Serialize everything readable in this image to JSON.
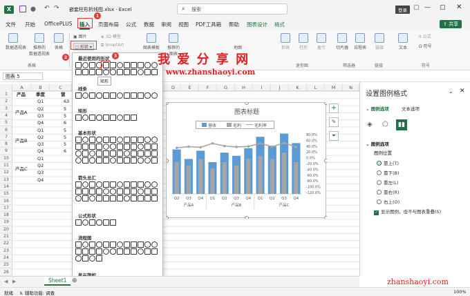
{
  "titlebar": {
    "filename": "嵌套柱形折线图.xlsx · Excel",
    "search_placeholder": "搜索",
    "login": "登录"
  },
  "tabs": [
    "文件",
    "开始",
    "OfficePLUS",
    "插入",
    "页面布局",
    "公式",
    "数据",
    "审阅",
    "视图",
    "PDF工具箱",
    "帮助",
    "图表设计",
    "格式"
  ],
  "share": "共享",
  "ribbon": {
    "buttons": {
      "pivot": "数据透视表",
      "recommended_pivot": "推荐的\n数据透视表",
      "table": "表格",
      "picture": "图片",
      "shape": "形状",
      "model3d": "3D 模型",
      "smartart": "SmartArt",
      "chart_template": "图表模板",
      "recommended_chart": "推荐的\n图表",
      "map": "地图",
      "line_spark": "折线",
      "column_spark": "柱形",
      "winloss": "盈亏",
      "slicer": "切片器",
      "timeline": "日程表",
      "link": "链接",
      "text": "文本",
      "symbol": "符号",
      "formula_sym": "公式",
      "omega": "Ω 符号"
    },
    "groups": {
      "tables": "表格",
      "sparklines": "迷你图",
      "filters": "筛选器",
      "links": "链接",
      "symbols": "符号"
    }
  },
  "namebox": "图表 5",
  "fx": "fx",
  "columns": [
    "A",
    "B",
    "C",
    "D",
    "E",
    "F",
    "G",
    "H",
    "I",
    "J",
    "K",
    "L",
    "M",
    "N"
  ],
  "rows": [
    "1",
    "2",
    "3",
    "4",
    "5",
    "6",
    "7",
    "8",
    "9",
    "10",
    "11",
    "12",
    "13",
    "14",
    "15",
    "16",
    "17",
    "18",
    "19",
    "20",
    "21",
    "22",
    "23",
    "24",
    "25",
    "26"
  ],
  "table": {
    "header": [
      "产品",
      "季度",
      "营"
    ],
    "groups": [
      {
        "name": "产品A",
        "quarters": [
          "Q1",
          "Q2",
          "Q3",
          "Q4"
        ],
        "partial": [
          "63",
          "5",
          "5",
          "6"
        ]
      },
      {
        "name": "产品B",
        "quarters": [
          "Q1",
          "Q2",
          "Q3",
          "Q4"
        ],
        "partial": [
          "5",
          "5",
          "5",
          "6"
        ]
      },
      {
        "name": "产品C",
        "quarters": [
          "Q1",
          "Q2",
          "Q3",
          "Q4"
        ],
        "partial": [
          "",
          "",
          "",
          ""
        ]
      }
    ]
  },
  "dropdown": {
    "recent": "最近使用的形状",
    "tooltip": "矩形",
    "lines": "线条",
    "rect": "矩形",
    "basic": "基本形状",
    "arrows": "箭头总汇",
    "equation": "公式形状",
    "flowchart": "流程图",
    "stars": "星与旗帜"
  },
  "chart_data": {
    "type": "bar",
    "title": "图表标题",
    "legend": [
      "营收",
      "毛利",
      "毛利率"
    ],
    "categories": [
      "Q2",
      "Q3",
      "Q4",
      "Q1",
      "Q2",
      "Q3",
      "Q4",
      "Q1",
      "Q2",
      "Q3",
      "Q4"
    ],
    "group_labels": [
      "产品A",
      "产品B",
      "产品C"
    ],
    "right_axis": [
      "80.0%",
      "60.0%",
      "40.0%",
      "20.0%",
      "0.0%",
      "-20.0%",
      "-40.0%",
      "-60.0%",
      "-80.0%",
      "-100.0%",
      "-120.0%"
    ],
    "series": [
      {
        "name": "营收",
        "values": [
          0.7,
          0.55,
          0.68,
          0.5,
          0.65,
          0.6,
          0.72,
          0.9,
          0.75,
          0.95,
          0.8
        ]
      },
      {
        "name": "毛利",
        "values": [
          0.5,
          0.45,
          0.55,
          0.4,
          0.5,
          0.45,
          0.55,
          0.6,
          0.55,
          0.65,
          0.5
        ]
      },
      {
        "name": "毛利率",
        "values": [
          0.4,
          0.45,
          0.42,
          0.6,
          0.48,
          0.44,
          0.46,
          0.6,
          0.45,
          0.62,
          0.44
        ]
      }
    ],
    "colors": {
      "bar1": "#5b9bd5",
      "bar2": "#a5a5a5",
      "line": "#a5a5a5"
    }
  },
  "pane": {
    "title": "设置图例格式",
    "tab1": "图例选项",
    "tab2": "文本选项",
    "section": "图例选项",
    "position_label": "图例位置",
    "options": [
      "靠上(T)",
      "靠下(B)",
      "靠左(L)",
      "靠右(R)",
      "右上(O)"
    ],
    "checkbox": "显示图例，但不与图表重叠(S)"
  },
  "sheet": "Sheet1",
  "status": {
    "ready": "就绪",
    "accessibility": "辅助功能: 调查",
    "zoom": "100%"
  },
  "watermark": {
    "cn": "我 爱 分 享 网",
    "url": "www.zhanshaoyi.com",
    "corner": "zhanshaoyi.com"
  },
  "badges": [
    "1",
    "2",
    "3"
  ],
  "accent": "#217346"
}
